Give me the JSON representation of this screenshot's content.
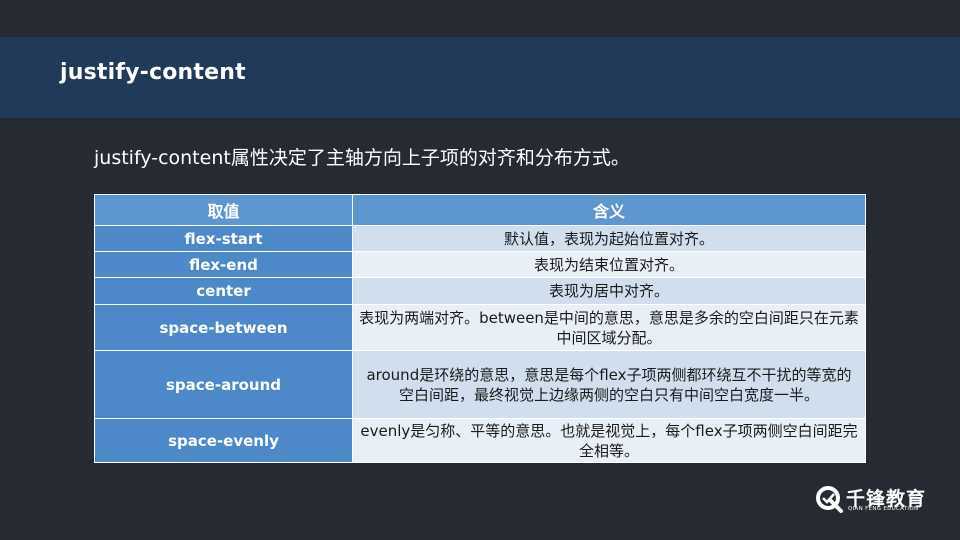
{
  "slide": {
    "title": "justify-content",
    "intro": "justify-content属性决定了主轴方向上子项的对齐和分布方式。"
  },
  "table": {
    "headers": [
      "取值",
      "含义"
    ],
    "rows": [
      {
        "value": "flex-start",
        "meaning": "默认值，表现为起始位置对齐。"
      },
      {
        "value": "flex-end",
        "meaning": "表现为结束位置对齐。"
      },
      {
        "value": "center",
        "meaning": "表现为居中对齐。"
      },
      {
        "value": "space-between",
        "meaning": "表现为两端对齐。between是中间的意思，意思是多余的空白间距只在元素中间区域分配。"
      },
      {
        "value": "space-around",
        "meaning": "around是环绕的意思，意思是每个flex子项两侧都环绕互不干扰的等宽的空白间距，最终视觉上边缘两侧的空白只有中间空白宽度一半。"
      },
      {
        "value": "space-evenly",
        "meaning": "evenly是匀称、平等的意思。也就是视觉上，每个flex子项两侧空白间距完全相等。"
      }
    ]
  },
  "logo": {
    "name": "千锋教育",
    "subtitle": "QIAN FENG EDUCATION"
  },
  "colors": {
    "background": "#252a33",
    "title_bar": "#213a59",
    "header": "#5e97d0",
    "key_cell": "#4d88c8",
    "row_dark": "#d0deee",
    "row_light": "#e9eff7"
  }
}
